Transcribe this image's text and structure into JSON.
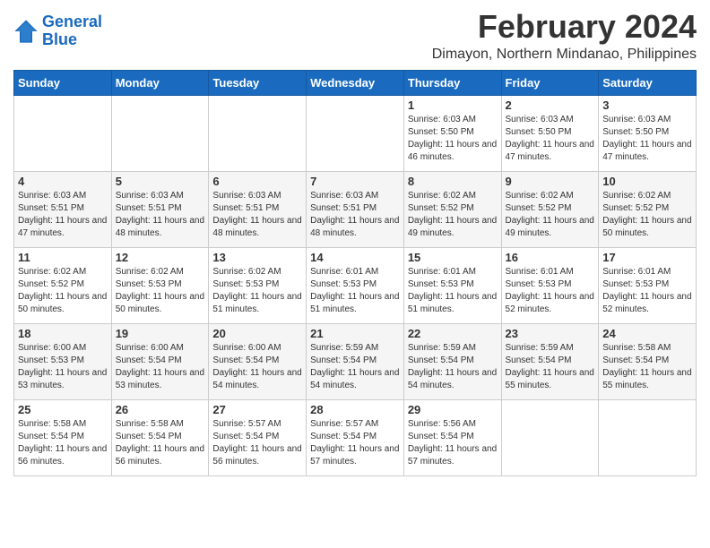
{
  "logo": {
    "line1": "General",
    "line2": "Blue"
  },
  "title": "February 2024",
  "location": "Dimayon, Northern Mindanao, Philippines",
  "weekdays": [
    "Sunday",
    "Monday",
    "Tuesday",
    "Wednesday",
    "Thursday",
    "Friday",
    "Saturday"
  ],
  "weeks": [
    [
      {
        "day": "",
        "sunrise": "",
        "sunset": "",
        "daylight": ""
      },
      {
        "day": "",
        "sunrise": "",
        "sunset": "",
        "daylight": ""
      },
      {
        "day": "",
        "sunrise": "",
        "sunset": "",
        "daylight": ""
      },
      {
        "day": "",
        "sunrise": "",
        "sunset": "",
        "daylight": ""
      },
      {
        "day": "1",
        "sunrise": "Sunrise: 6:03 AM",
        "sunset": "Sunset: 5:50 PM",
        "daylight": "Daylight: 11 hours and 46 minutes."
      },
      {
        "day": "2",
        "sunrise": "Sunrise: 6:03 AM",
        "sunset": "Sunset: 5:50 PM",
        "daylight": "Daylight: 11 hours and 47 minutes."
      },
      {
        "day": "3",
        "sunrise": "Sunrise: 6:03 AM",
        "sunset": "Sunset: 5:50 PM",
        "daylight": "Daylight: 11 hours and 47 minutes."
      }
    ],
    [
      {
        "day": "4",
        "sunrise": "Sunrise: 6:03 AM",
        "sunset": "Sunset: 5:51 PM",
        "daylight": "Daylight: 11 hours and 47 minutes."
      },
      {
        "day": "5",
        "sunrise": "Sunrise: 6:03 AM",
        "sunset": "Sunset: 5:51 PM",
        "daylight": "Daylight: 11 hours and 48 minutes."
      },
      {
        "day": "6",
        "sunrise": "Sunrise: 6:03 AM",
        "sunset": "Sunset: 5:51 PM",
        "daylight": "Daylight: 11 hours and 48 minutes."
      },
      {
        "day": "7",
        "sunrise": "Sunrise: 6:03 AM",
        "sunset": "Sunset: 5:51 PM",
        "daylight": "Daylight: 11 hours and 48 minutes."
      },
      {
        "day": "8",
        "sunrise": "Sunrise: 6:02 AM",
        "sunset": "Sunset: 5:52 PM",
        "daylight": "Daylight: 11 hours and 49 minutes."
      },
      {
        "day": "9",
        "sunrise": "Sunrise: 6:02 AM",
        "sunset": "Sunset: 5:52 PM",
        "daylight": "Daylight: 11 hours and 49 minutes."
      },
      {
        "day": "10",
        "sunrise": "Sunrise: 6:02 AM",
        "sunset": "Sunset: 5:52 PM",
        "daylight": "Daylight: 11 hours and 50 minutes."
      }
    ],
    [
      {
        "day": "11",
        "sunrise": "Sunrise: 6:02 AM",
        "sunset": "Sunset: 5:52 PM",
        "daylight": "Daylight: 11 hours and 50 minutes."
      },
      {
        "day": "12",
        "sunrise": "Sunrise: 6:02 AM",
        "sunset": "Sunset: 5:53 PM",
        "daylight": "Daylight: 11 hours and 50 minutes."
      },
      {
        "day": "13",
        "sunrise": "Sunrise: 6:02 AM",
        "sunset": "Sunset: 5:53 PM",
        "daylight": "Daylight: 11 hours and 51 minutes."
      },
      {
        "day": "14",
        "sunrise": "Sunrise: 6:01 AM",
        "sunset": "Sunset: 5:53 PM",
        "daylight": "Daylight: 11 hours and 51 minutes."
      },
      {
        "day": "15",
        "sunrise": "Sunrise: 6:01 AM",
        "sunset": "Sunset: 5:53 PM",
        "daylight": "Daylight: 11 hours and 51 minutes."
      },
      {
        "day": "16",
        "sunrise": "Sunrise: 6:01 AM",
        "sunset": "Sunset: 5:53 PM",
        "daylight": "Daylight: 11 hours and 52 minutes."
      },
      {
        "day": "17",
        "sunrise": "Sunrise: 6:01 AM",
        "sunset": "Sunset: 5:53 PM",
        "daylight": "Daylight: 11 hours and 52 minutes."
      }
    ],
    [
      {
        "day": "18",
        "sunrise": "Sunrise: 6:00 AM",
        "sunset": "Sunset: 5:53 PM",
        "daylight": "Daylight: 11 hours and 53 minutes."
      },
      {
        "day": "19",
        "sunrise": "Sunrise: 6:00 AM",
        "sunset": "Sunset: 5:54 PM",
        "daylight": "Daylight: 11 hours and 53 minutes."
      },
      {
        "day": "20",
        "sunrise": "Sunrise: 6:00 AM",
        "sunset": "Sunset: 5:54 PM",
        "daylight": "Daylight: 11 hours and 54 minutes."
      },
      {
        "day": "21",
        "sunrise": "Sunrise: 5:59 AM",
        "sunset": "Sunset: 5:54 PM",
        "daylight": "Daylight: 11 hours and 54 minutes."
      },
      {
        "day": "22",
        "sunrise": "Sunrise: 5:59 AM",
        "sunset": "Sunset: 5:54 PM",
        "daylight": "Daylight: 11 hours and 54 minutes."
      },
      {
        "day": "23",
        "sunrise": "Sunrise: 5:59 AM",
        "sunset": "Sunset: 5:54 PM",
        "daylight": "Daylight: 11 hours and 55 minutes."
      },
      {
        "day": "24",
        "sunrise": "Sunrise: 5:58 AM",
        "sunset": "Sunset: 5:54 PM",
        "daylight": "Daylight: 11 hours and 55 minutes."
      }
    ],
    [
      {
        "day": "25",
        "sunrise": "Sunrise: 5:58 AM",
        "sunset": "Sunset: 5:54 PM",
        "daylight": "Daylight: 11 hours and 56 minutes."
      },
      {
        "day": "26",
        "sunrise": "Sunrise: 5:58 AM",
        "sunset": "Sunset: 5:54 PM",
        "daylight": "Daylight: 11 hours and 56 minutes."
      },
      {
        "day": "27",
        "sunrise": "Sunrise: 5:57 AM",
        "sunset": "Sunset: 5:54 PM",
        "daylight": "Daylight: 11 hours and 56 minutes."
      },
      {
        "day": "28",
        "sunrise": "Sunrise: 5:57 AM",
        "sunset": "Sunset: 5:54 PM",
        "daylight": "Daylight: 11 hours and 57 minutes."
      },
      {
        "day": "29",
        "sunrise": "Sunrise: 5:56 AM",
        "sunset": "Sunset: 5:54 PM",
        "daylight": "Daylight: 11 hours and 57 minutes."
      },
      {
        "day": "",
        "sunrise": "",
        "sunset": "",
        "daylight": ""
      },
      {
        "day": "",
        "sunrise": "",
        "sunset": "",
        "daylight": ""
      }
    ]
  ]
}
